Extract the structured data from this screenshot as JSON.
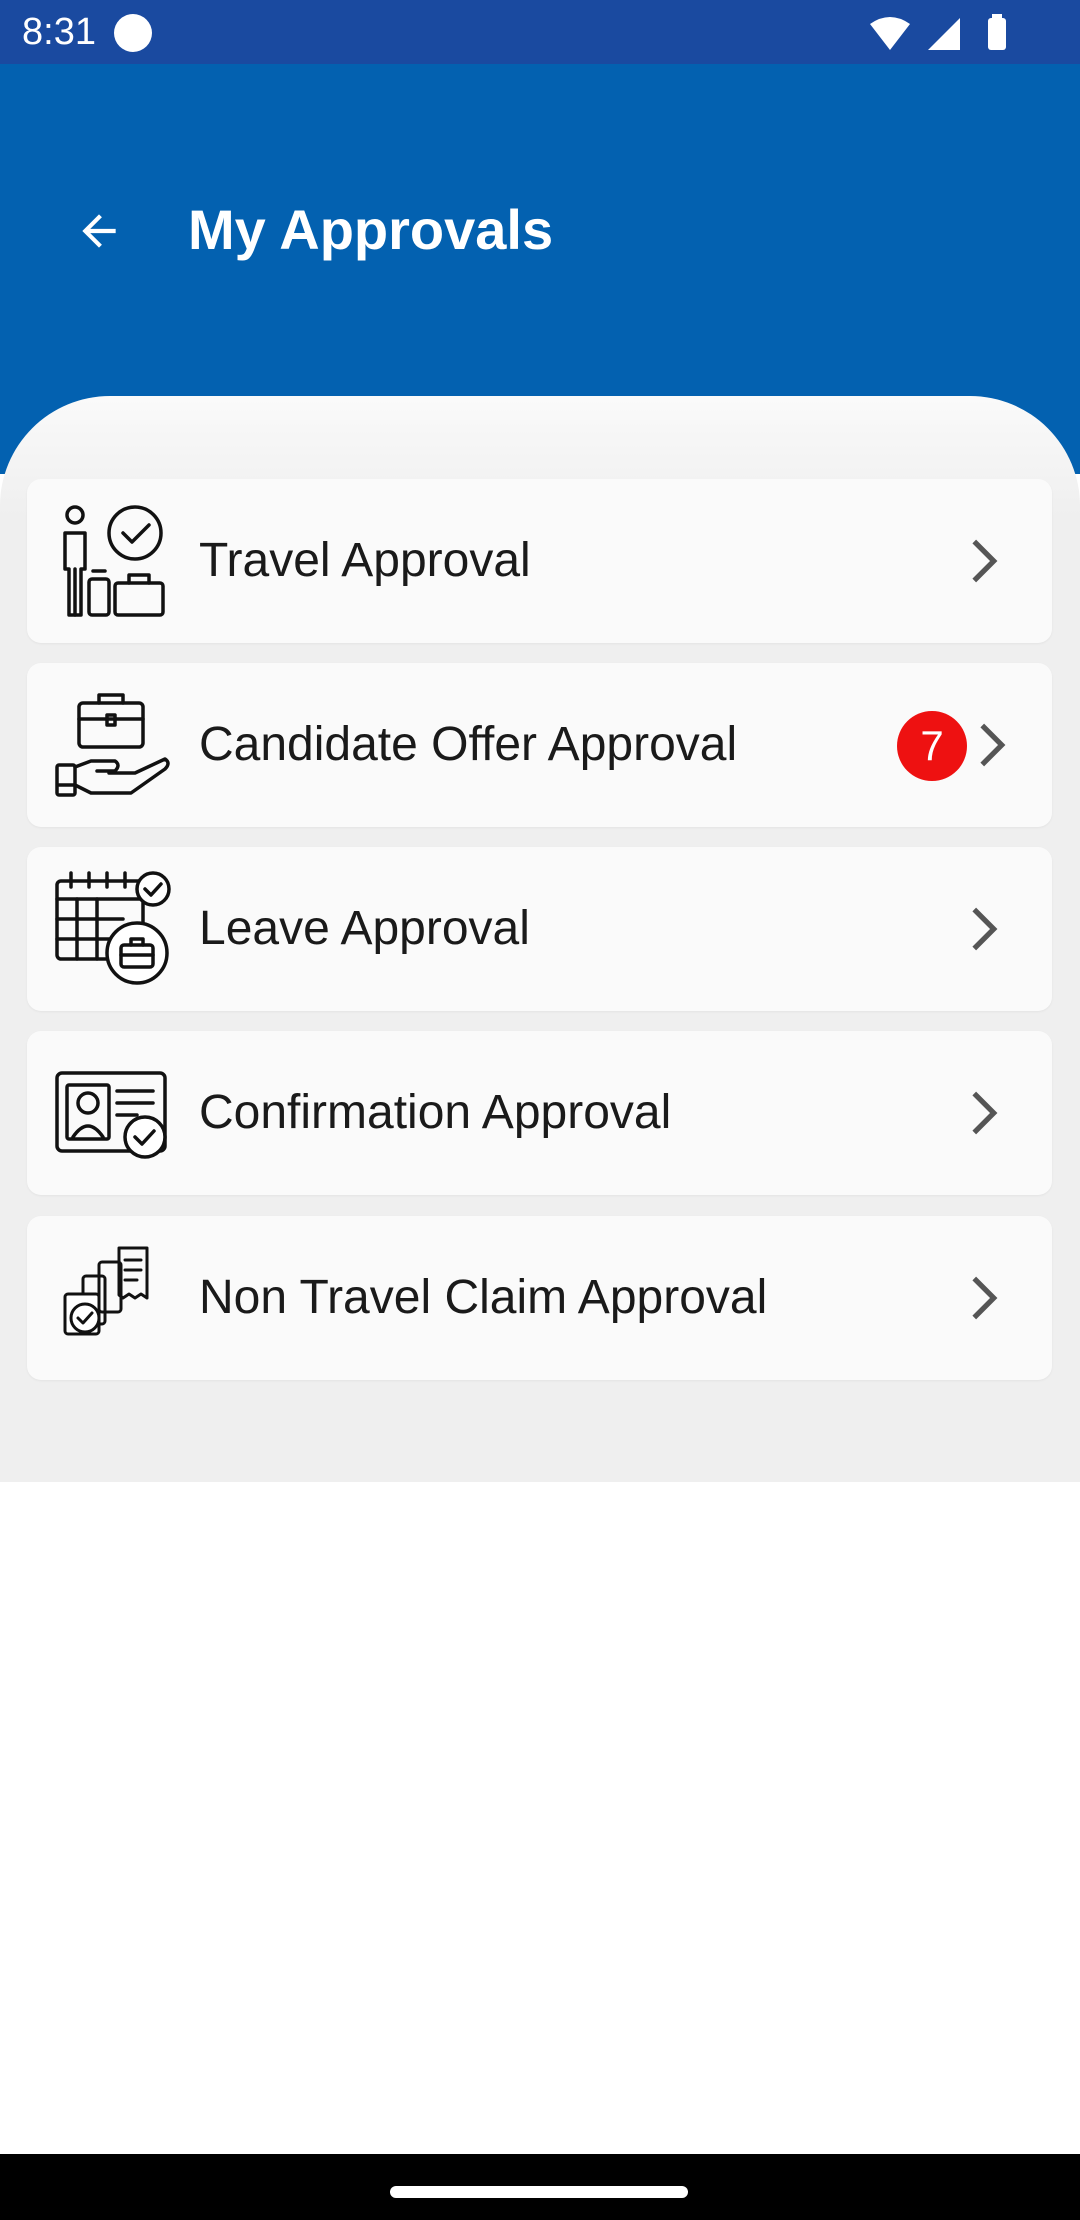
{
  "status_bar": {
    "time": "8:31"
  },
  "header": {
    "title": "My Approvals"
  },
  "approvals": [
    {
      "label": "Travel Approval",
      "icon": "travel-approval-icon"
    },
    {
      "label": "Candidate Offer Approval",
      "icon": "candidate-offer-icon",
      "badge": "7"
    },
    {
      "label": "Leave Approval",
      "icon": "leave-approval-icon"
    },
    {
      "label": "Confirmation Approval",
      "icon": "confirmation-approval-icon"
    },
    {
      "label": "Non Travel Claim Approval",
      "icon": "claim-approval-icon"
    }
  ],
  "colors": {
    "status_bar": "#1a4aa0",
    "header": "#0361b0",
    "badge": "#ee1111"
  }
}
